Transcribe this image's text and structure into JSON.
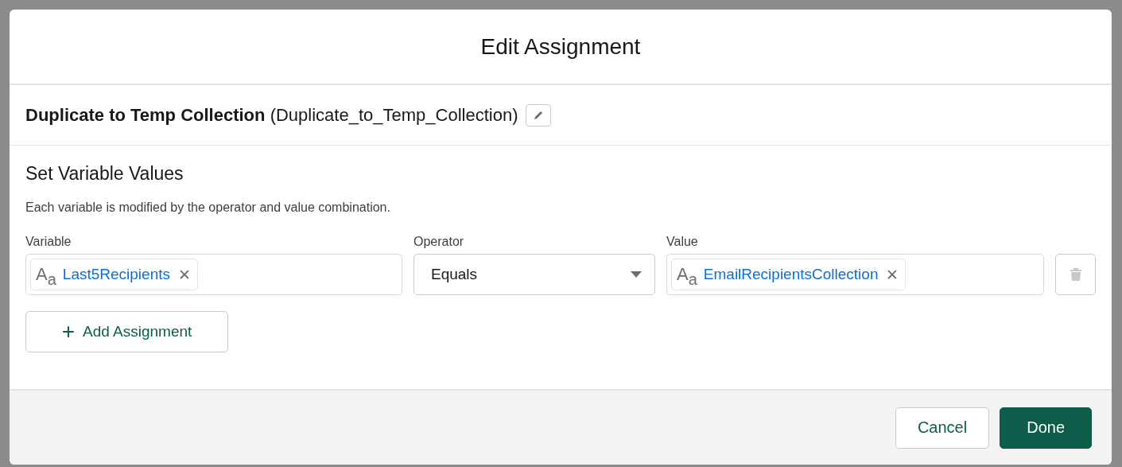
{
  "dialog": {
    "title": "Edit Assignment"
  },
  "element": {
    "label": "Duplicate to Temp Collection",
    "api_name": "(Duplicate_to_Temp_Collection)"
  },
  "section": {
    "title": "Set Variable Values",
    "description": "Each variable is modified by the operator and value combination."
  },
  "columns": {
    "variable": "Variable",
    "operator": "Operator",
    "value": "Value"
  },
  "assignments": [
    {
      "variable": {
        "type_glyph": [
          "A",
          "a"
        ],
        "name": "Last5Recipients",
        "remove": "✕"
      },
      "operator": "Equals",
      "value": {
        "type_glyph": [
          "A",
          "a"
        ],
        "name": "EmailRecipientsCollection",
        "remove": "✕"
      },
      "delete_disabled": true
    }
  ],
  "add_button": {
    "icon": "+",
    "label": "Add Assignment"
  },
  "footer": {
    "buttons": [
      {
        "label": "Cancel",
        "kind": "neutral"
      },
      {
        "label": "Done",
        "kind": "brand"
      }
    ]
  }
}
